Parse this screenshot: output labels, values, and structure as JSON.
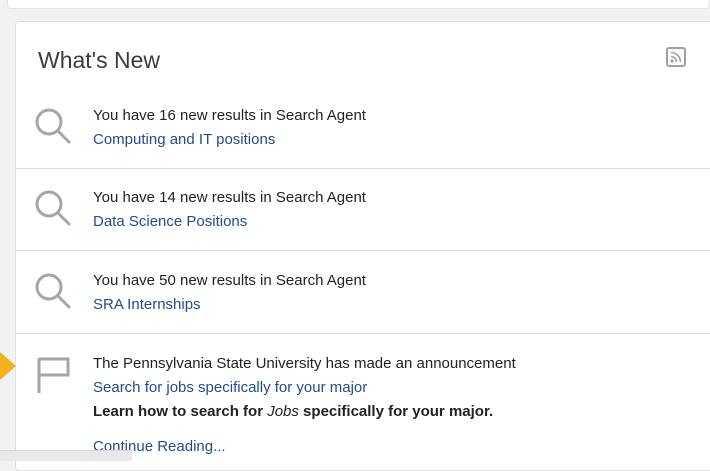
{
  "widget": {
    "title": "What's New",
    "rss_icon": "rss-icon",
    "items": [
      {
        "icon": "search-icon",
        "message": "You have 16 new results in Search Agent",
        "link": "Computing and IT positions"
      },
      {
        "icon": "search-icon",
        "message": "You have 14 new results in Search Agent",
        "link": "Data Science Positions"
      },
      {
        "icon": "search-icon",
        "message": "You have 50 new results in Search Agent",
        "link": "SRA Internships"
      },
      {
        "icon": "flag-icon",
        "message": "The Pennsylvania State University has made an announcement",
        "link": "Search for jobs specifically for your major",
        "summary": {
          "part1": "Learn how to search for ",
          "emphasis": "Jobs",
          "part2": " specifically for your major."
        },
        "continue_label": "Continue Reading..."
      }
    ]
  },
  "colors": {
    "link": "#1f4d8c",
    "icon": "#a6a6a6",
    "marker": "#f3b21b",
    "divider": "#dcdcdc"
  }
}
